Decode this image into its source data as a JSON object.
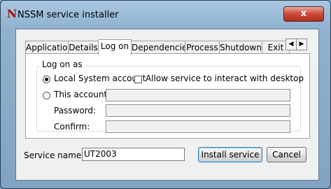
{
  "window": {
    "title": "NSSM service installer",
    "close_glyph": "x"
  },
  "app_icon": {
    "glyph": "N",
    "name": "nssm-logo-icon"
  },
  "tabs": [
    {
      "label": "Application"
    },
    {
      "label": "Details"
    },
    {
      "label": "Log on"
    },
    {
      "label": "Dependencies"
    },
    {
      "label": "Process"
    },
    {
      "label": "Shutdown"
    },
    {
      "label": "Exit"
    }
  ],
  "logon": {
    "group_label": "Log on as",
    "local_system_label": "Local System account",
    "interact_desktop_label": "Allow service to interact with desktop",
    "this_account_label": "This account:",
    "password_label": "Password:",
    "confirm_label": "Confirm:",
    "account_value": "",
    "password_value": "",
    "confirm_value": ""
  },
  "footer": {
    "service_name_label": "Service name:",
    "service_name_value": "UT2003",
    "install_button": "Install service",
    "cancel_button": "Cancel"
  },
  "colors": {
    "close_button": "#c9493a",
    "title_bar": "#a9c8e2"
  }
}
